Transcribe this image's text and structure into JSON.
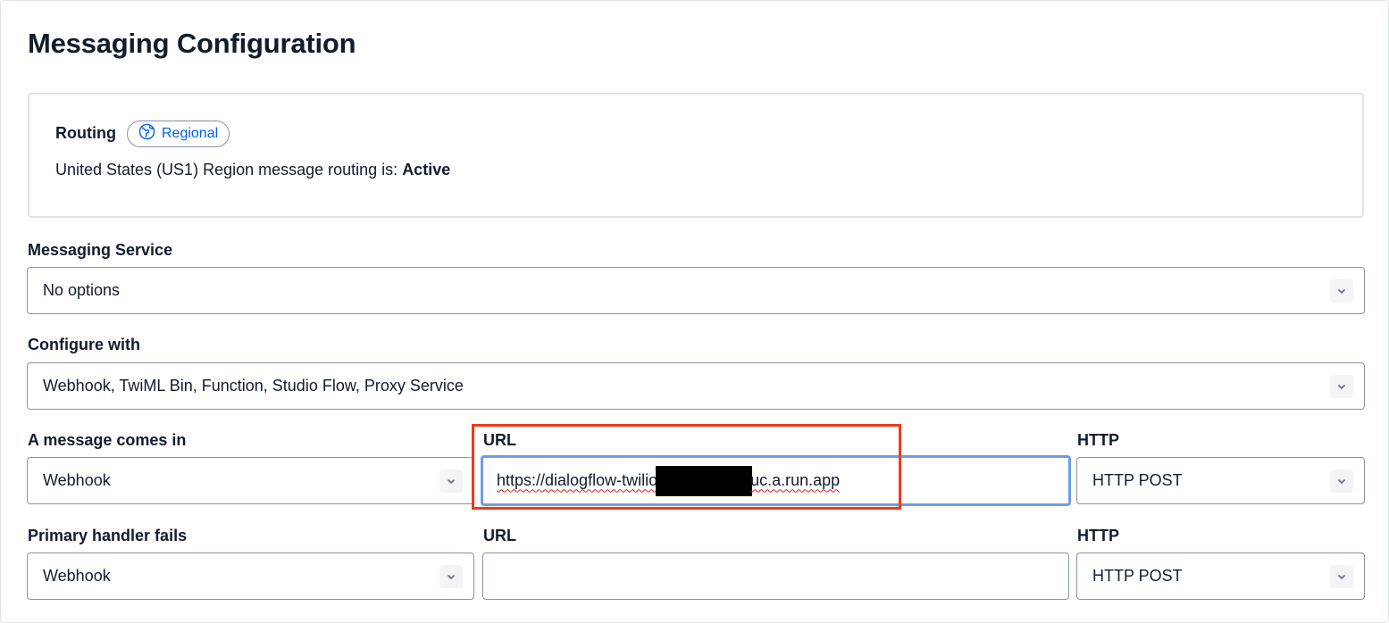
{
  "page": {
    "title": "Messaging Configuration"
  },
  "routing": {
    "label": "Routing",
    "badge": "Regional",
    "text_prefix": "United States (US1) Region message routing is: ",
    "status": "Active"
  },
  "messaging_service": {
    "label": "Messaging Service",
    "value": "No options"
  },
  "configure_with": {
    "label": "Configure with",
    "value": "Webhook, TwiML Bin, Function, Studio Flow, Proxy Service"
  },
  "message_comes_in": {
    "label": "A message comes in",
    "handler": "Webhook",
    "url_label": "URL",
    "url_start": "https://dialogflow-twilio",
    "url_end": "uc.a.run.app",
    "http_label": "HTTP",
    "http_method": "HTTP POST"
  },
  "primary_handler_fails": {
    "label": "Primary handler fails",
    "handler": "Webhook",
    "url_label": "URL",
    "url_value": "",
    "http_label": "HTTP",
    "http_method": "HTTP POST"
  },
  "icons": {
    "globe": "globe-icon",
    "chevron": "chevron-down-icon"
  },
  "colors": {
    "link_blue": "#0263e0",
    "focus_border": "#6d9eeb",
    "highlight_red": "#ee3a1c"
  }
}
